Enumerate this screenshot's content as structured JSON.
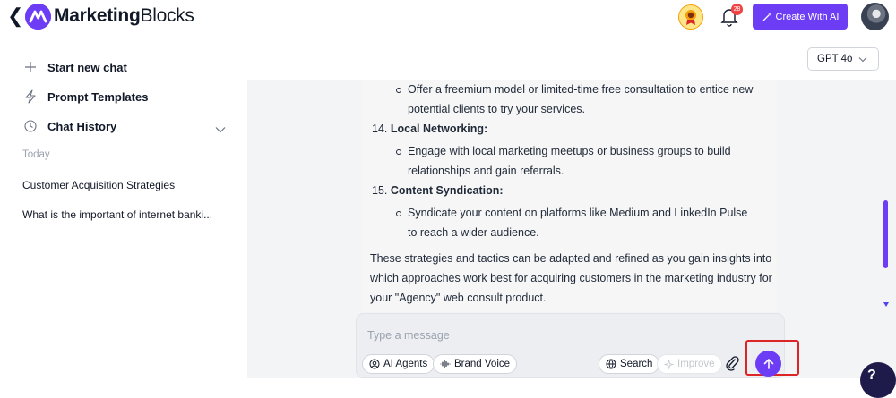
{
  "header": {
    "logo_bold": "Marketing",
    "logo_regular": "Blocks",
    "notification_count": "28",
    "create_button": "Create With AI"
  },
  "sidebar": {
    "start_new_chat": "Start new chat",
    "prompt_templates": "Prompt Templates",
    "chat_history": "Chat History",
    "today": "Today",
    "history": [
      "Customer Acquisition Strategies",
      "What is the important of internet banki..."
    ]
  },
  "model": {
    "selected": "GPT 4o"
  },
  "message": {
    "bullet_top_line1": "Offer a freemium model or limited-time free consultation to entice new",
    "bullet_top_line2": "potential clients to try your services.",
    "item14_num": "14.",
    "item14_title": "Local Networking:",
    "item14_line1": "Engage with local marketing meetups or business groups to build",
    "item14_line2": "relationships and gain referrals.",
    "item15_num": "15.",
    "item15_title": "Content Syndication:",
    "item15_line1": "Syndicate your content on platforms like Medium and LinkedIn Pulse",
    "item15_line2": "to reach a wider audience.",
    "closing_line1": "These strategies and tactics can be adapted and refined as you gain insights into",
    "closing_line2": "which approaches work best for acquiring customers in the marketing industry for",
    "closing_line3": "your \"Agency\" web consult product."
  },
  "composer": {
    "placeholder": "Type a message",
    "ai_agents": "AI Agents",
    "brand_voice": "Brand Voice",
    "search": "Search",
    "improve": "Improve"
  },
  "help": {
    "label": "?"
  },
  "colors": {
    "accent": "#6d3df5",
    "highlight_border": "#dc2626"
  }
}
